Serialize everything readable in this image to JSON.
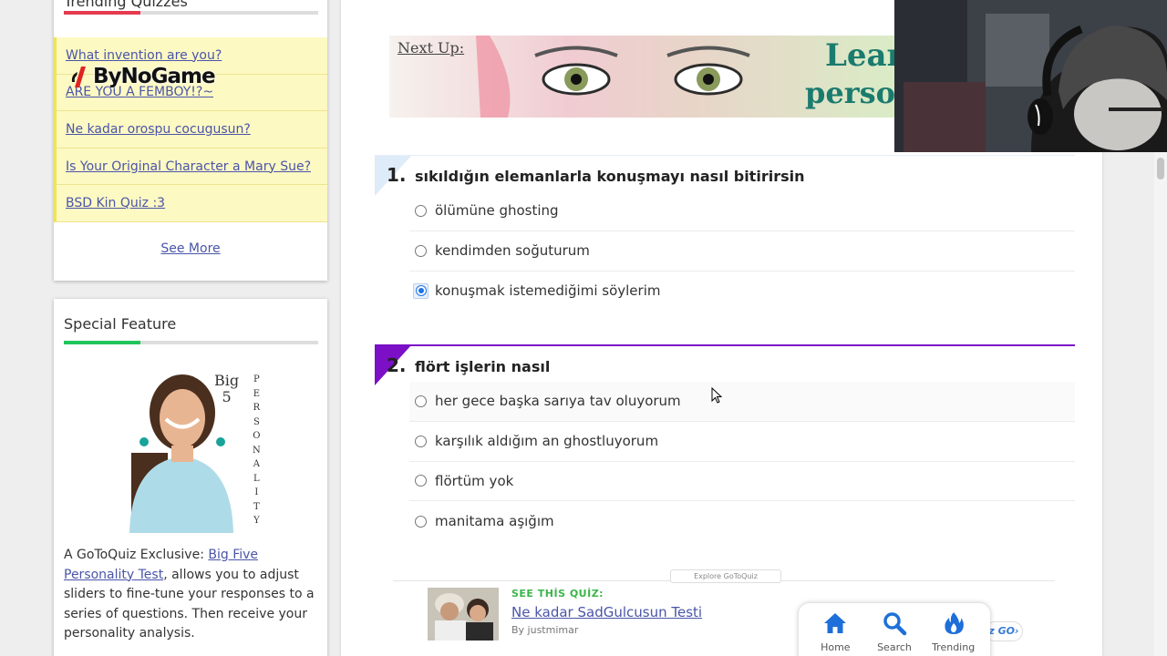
{
  "sidebar": {
    "trending": {
      "title": "Trending Quizzes",
      "items": [
        {
          "label": "What invention are you?"
        },
        {
          "label": "ARE YOU A FEMBOY!?~"
        },
        {
          "label": "Ne kadar orospu cocugusun?"
        },
        {
          "label": "Is Your Original Character a Mary Sue?"
        },
        {
          "label": "BSD Kin Quiz :3"
        }
      ],
      "see_more": "See More"
    },
    "special": {
      "title": "Special Feature",
      "image_text": {
        "big": "Big",
        "five": "5",
        "personality": [
          "P",
          "E",
          "R",
          "S",
          "O",
          "N",
          "A",
          "L",
          "I",
          "T",
          "Y"
        ]
      },
      "text_before": "A GoToQuiz Exclusive: ",
      "link": "Big Five Personality Test",
      "text_after": ", allows you to adjust sliders to fine-tune your responses to a series of questions. Then receive your personality analysis."
    }
  },
  "watermark": {
    "text": "ByNoGame"
  },
  "main": {
    "next_up": {
      "label": "Next Up:",
      "text_line1": "Lear",
      "text_line2": "person"
    },
    "questions": [
      {
        "number": "1.",
        "text": "sıkıldığın elemanlarla konuşmayı nasıl bitirirsin",
        "options": [
          "ölümüne ghosting",
          "kendimden soğuturum",
          "konuşmak istemediğimi söylerim"
        ],
        "selected": 2,
        "accent": "#deebf8"
      },
      {
        "number": "2.",
        "text": "flört işlerin nasıl",
        "options": [
          "her gece başka sarıya tav oluyorum",
          "karşılık aldığım an ghostluyorum",
          "flörtüm yok",
          "manitama aşığım"
        ],
        "selected": -1,
        "accent": "#7b10c6"
      }
    ],
    "explore": "Explore GoToQuiz",
    "see_quiz": {
      "label": "SEE THİS QUİZ:",
      "title": "Ne kadar SadGulcusun Testi",
      "by": "By justmimar"
    },
    "go_pill": "z GO›"
  },
  "bottom_nav": {
    "items": [
      {
        "label": "Home",
        "icon": "home-icon"
      },
      {
        "label": "Search",
        "icon": "search-icon"
      },
      {
        "label": "Trending",
        "icon": "flame-icon"
      }
    ]
  },
  "colors": {
    "link": "#4a55a8",
    "trending_accent": "#e53950",
    "special_accent": "#20c55a",
    "q2_accent": "#7b10c6",
    "radio_checked": "#1a73e8",
    "nav_blue": "#1e6fd9"
  }
}
